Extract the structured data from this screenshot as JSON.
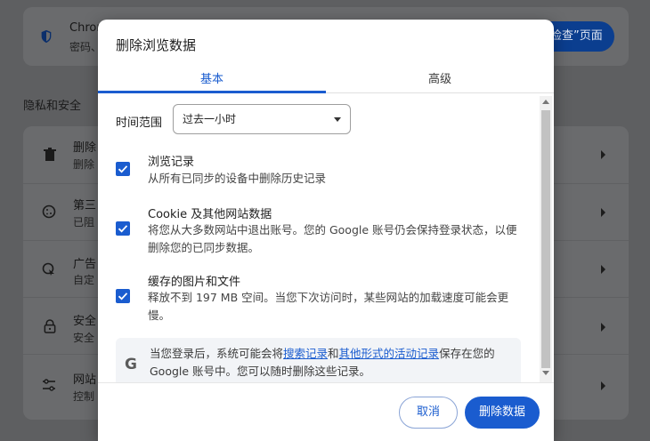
{
  "background": {
    "top_card": {
      "title": "Chrom",
      "subtitle": "密码、",
      "button_label": "检查”页面"
    },
    "section_heading": "隐私和安全",
    "rows": [
      {
        "icon": "trash-icon",
        "title": "删除",
        "subtitle": "删除"
      },
      {
        "icon": "cookie-icon",
        "title": "第三",
        "subtitle": "已阻"
      },
      {
        "icon": "ad-privacy-icon",
        "title": "广告",
        "subtitle": "自定"
      },
      {
        "icon": "lock-icon",
        "title": "安全",
        "subtitle": "安全"
      },
      {
        "icon": "sliders-icon",
        "title": "网站",
        "subtitle": "控制"
      }
    ]
  },
  "dialog": {
    "title": "删除浏览数据",
    "tabs": [
      {
        "label": "基本",
        "active": true
      },
      {
        "label": "高级",
        "active": false
      }
    ],
    "time_range": {
      "label": "时间范围",
      "selected": "过去一小时"
    },
    "options": [
      {
        "title": "浏览记录",
        "description": "从所有已同步的设备中删除历史记录",
        "checked": true
      },
      {
        "title": "Cookie 及其他网站数据",
        "description": "将您从大多数网站中退出账号。您的 Google 账号仍会保持登录状态，以便删除您的已同步数据。",
        "checked": true
      },
      {
        "title": "缓存的图片和文件",
        "description": "释放不到 197 MB 空间。当您下次访问时，某些网站的加载速度可能会更慢。",
        "checked": true
      }
    ],
    "info": {
      "logo": "G",
      "text_before": "当您登录后，系统可能会将",
      "link1": "搜索记录",
      "text_mid": "和",
      "link2": "其他形式的活动记录",
      "text_after": "保存在您的 Google 账号中。您可以随时删除这些记录。"
    },
    "buttons": {
      "cancel": "取消",
      "confirm": "删除数据"
    }
  },
  "colors": {
    "accent": "#1a5ccf",
    "overlay": "#5e5f61"
  }
}
